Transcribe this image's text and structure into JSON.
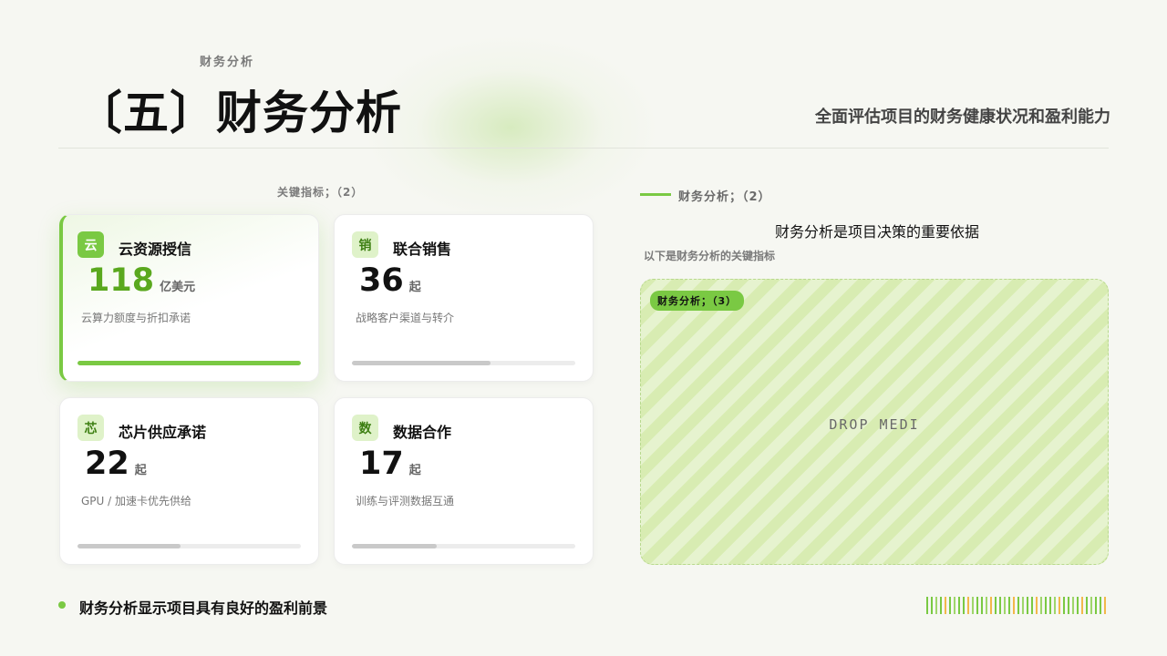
{
  "header": {
    "eyebrow": "财务分析",
    "title": "〔五〕财务分析",
    "subtitle": "全面评估项目的财务健康状况和盈利能力"
  },
  "left_section": {
    "label": "关键指标；（2）"
  },
  "cards": [
    {
      "icon_char": "云",
      "icon": "cloud-icon",
      "name": "云资源授信",
      "value": "118",
      "unit": "亿美元",
      "desc": "云算力额度与折扣承诺",
      "progress": 1.0,
      "active": true
    },
    {
      "icon_char": "销",
      "icon": "sales-icon",
      "name": "联合销售",
      "value": "36",
      "unit": "起",
      "desc": "战略客户渠道与转介",
      "progress": 0.62,
      "active": false
    },
    {
      "icon_char": "芯",
      "icon": "chip-icon",
      "name": "芯片供应承诺",
      "value": "22",
      "unit": "起",
      "desc": "GPU / 加速卡优先供给",
      "progress": 0.46,
      "active": false
    },
    {
      "icon_char": "数",
      "icon": "data-icon",
      "name": "数据合作",
      "value": "17",
      "unit": "起",
      "desc": "训练与评测数据互通",
      "progress": 0.38,
      "active": false
    }
  ],
  "right_section": {
    "label": "财务分析；（2）",
    "title": "财务分析是项目决策的重要依据",
    "subtitle": "以下是财务分析的关键指标",
    "media_tag": "财务分析；（3）",
    "media_placeholder": "DROP MEDI"
  },
  "footer": {
    "text": "财务分析显示项目具有良好的盈利前景"
  },
  "colors": {
    "accent": "#7ac943",
    "accent_dark": "#5aa81e",
    "stripe_palette": [
      "#7ac943",
      "#f2b84b",
      "#9fd66b",
      "#5aa81e"
    ]
  }
}
